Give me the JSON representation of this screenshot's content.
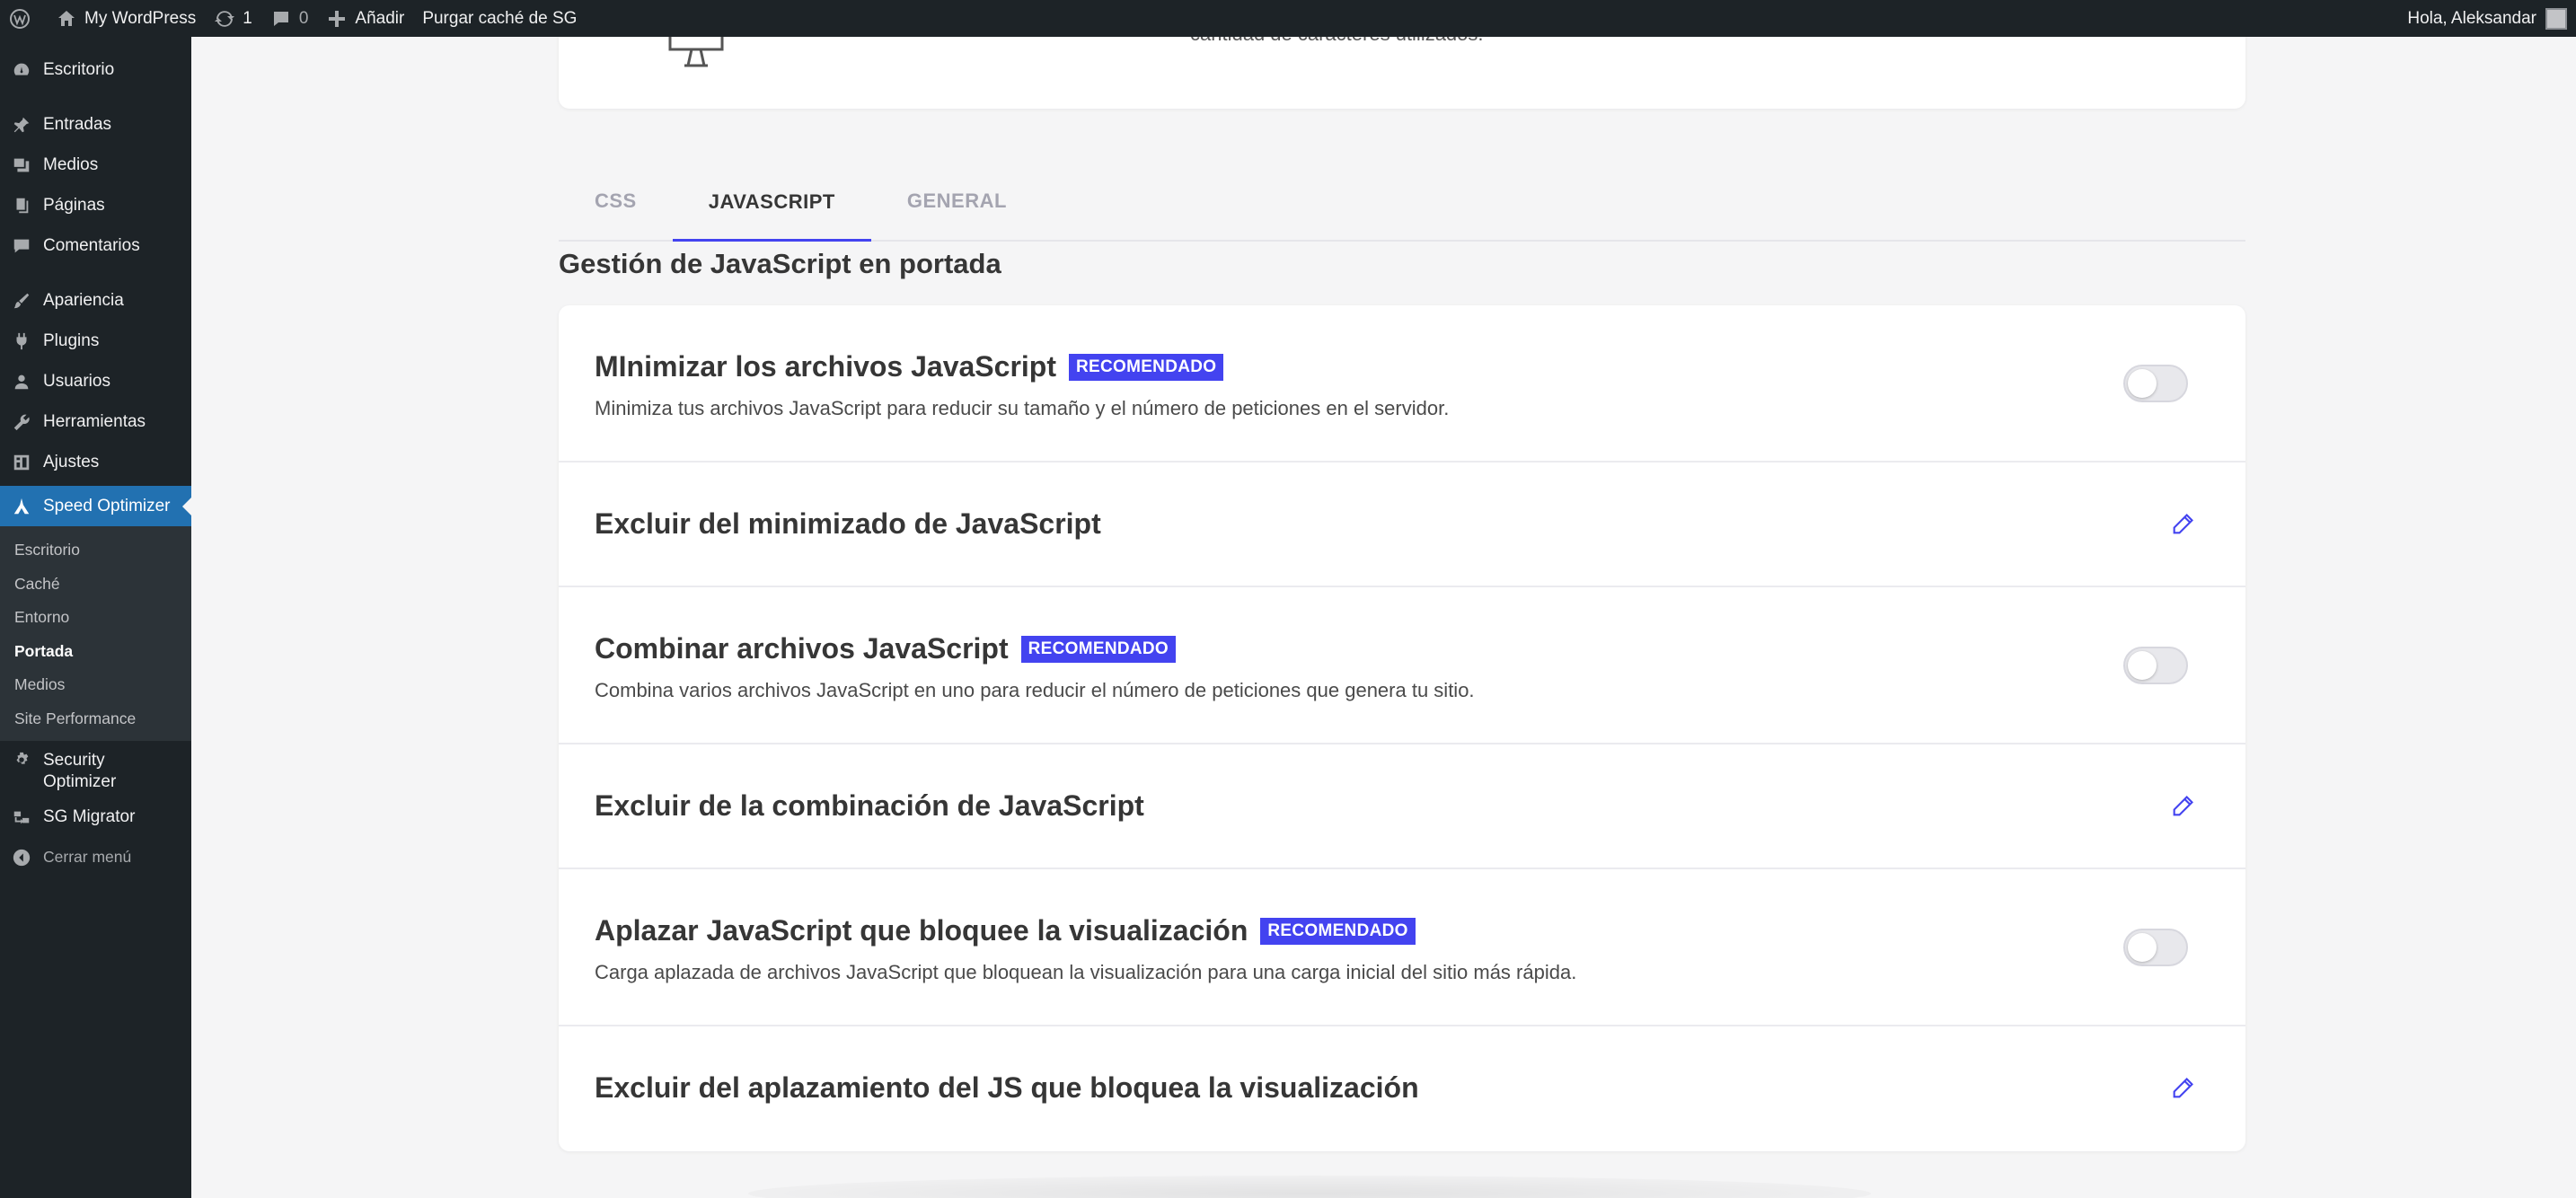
{
  "adminbar": {
    "site_name": "My WordPress",
    "updates_count": "1",
    "comments_count": "0",
    "add_new": "Añadir",
    "purge_cache": "Purgar caché de SG",
    "greeting": "Hola, Aleksandar"
  },
  "sidebar": {
    "items": [
      {
        "label": "Escritorio",
        "icon": "dashboard-icon"
      },
      {
        "label": "Entradas",
        "icon": "pin-icon"
      },
      {
        "label": "Medios",
        "icon": "media-icon"
      },
      {
        "label": "Páginas",
        "icon": "pages-icon"
      },
      {
        "label": "Comentarios",
        "icon": "comment-icon"
      },
      {
        "label": "Apariencia",
        "icon": "brush-icon"
      },
      {
        "label": "Plugins",
        "icon": "plugin-icon"
      },
      {
        "label": "Usuarios",
        "icon": "user-icon"
      },
      {
        "label": "Herramientas",
        "icon": "wrench-icon"
      },
      {
        "label": "Ajustes",
        "icon": "settings-icon"
      },
      {
        "label": "Speed Optimizer",
        "icon": "speed-optimizer-icon"
      }
    ],
    "submenu": [
      "Escritorio",
      "Caché",
      "Entorno",
      "Portada",
      "Medios",
      "Site Performance"
    ],
    "after": [
      {
        "label": "Security Optimizer",
        "icon": "gear-icon"
      },
      {
        "label": "SG Migrator",
        "icon": "migrator-icon"
      }
    ],
    "collapse": "Cerrar menú"
  },
  "top_card": {
    "cut_text": "cantidad de caracteres utilizados."
  },
  "tabs": [
    "CSS",
    "JAVASCRIPT",
    "GENERAL"
  ],
  "section_title": "Gestión de JavaScript en portada",
  "badge": "RECOMENDADO",
  "rows": [
    {
      "title": "MInimizar los archivos JavaScript",
      "desc": "Minimiza tus archivos JavaScript para reducir su tamaño y el número de peticiones en el servidor.",
      "enabled": false
    },
    {
      "title": "Excluir del minimizado de JavaScript"
    },
    {
      "title": "Combinar archivos JavaScript",
      "desc": "Combina varios archivos JavaScript en uno para reducir el número de peticiones que genera tu sitio.",
      "enabled": false
    },
    {
      "title": "Excluir de la combinación de JavaScript"
    },
    {
      "title": "Aplazar JavaScript que bloquee la visualización",
      "desc": "Carga aplazada de archivos JavaScript que bloquean la visualización para una carga inicial del sitio más rápida.",
      "enabled": false
    },
    {
      "title": "Excluir del aplazamiento del JS que bloquea la visualización"
    }
  ],
  "colors": {
    "accent": "#4343f0",
    "wp_blue": "#2271b1",
    "admin_dark": "#1d2327"
  }
}
